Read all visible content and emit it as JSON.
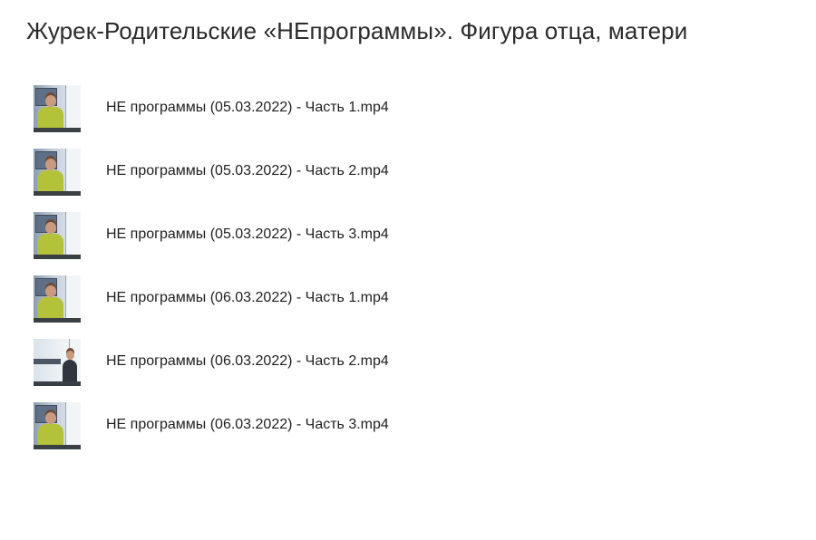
{
  "page": {
    "title": "Журек-Родительские «НЕпрограммы». Фигура отца, матери"
  },
  "files": [
    {
      "name": "НЕ программы (05.03.2022) - Часть 1.mp4",
      "thumbnail_icon": "video-thumbnail"
    },
    {
      "name": "НЕ программы (05.03.2022) - Часть 2.mp4",
      "thumbnail_icon": "video-thumbnail"
    },
    {
      "name": "НЕ программы (05.03.2022) - Часть 3.mp4",
      "thumbnail_icon": "video-thumbnail"
    },
    {
      "name": "НЕ программы (06.03.2022) - Часть 1.mp4",
      "thumbnail_icon": "video-thumbnail"
    },
    {
      "name": "НЕ программы (06.03.2022) - Часть 2.mp4",
      "thumbnail_icon": "video-thumbnail"
    },
    {
      "name": "НЕ программы (06.03.2022) - Часть 3.mp4",
      "thumbnail_icon": "video-thumbnail"
    }
  ]
}
